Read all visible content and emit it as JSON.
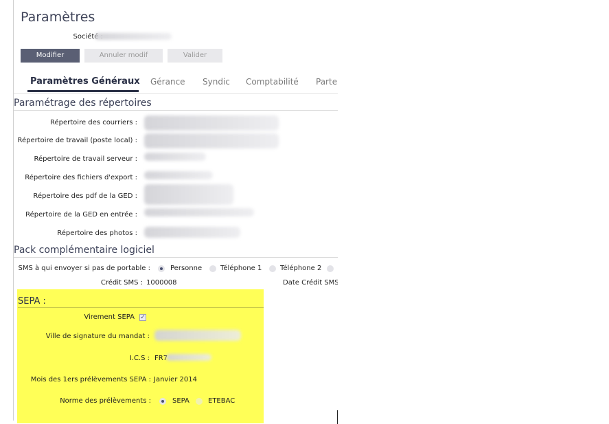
{
  "page": {
    "title": "Paramètres"
  },
  "company": {
    "label": "Société :"
  },
  "toolbar": {
    "modify": "Modifier",
    "cancel": "Annuler modif",
    "validate": "Valider"
  },
  "tabs": [
    {
      "label": "Paramètres Généraux",
      "active": true
    },
    {
      "label": "Gérance"
    },
    {
      "label": "Syndic"
    },
    {
      "label": "Comptabilité"
    },
    {
      "label": "Parte"
    }
  ],
  "directories": {
    "title": "Paramétrage des répertoires",
    "rows": [
      {
        "label": "Répertoire des courriers :"
      },
      {
        "label": "Répertoire de travail (poste local) :"
      },
      {
        "label": "Répertoire de travail serveur :"
      },
      {
        "label": "Répertoire des fichiers d'export :"
      },
      {
        "label": "Répertoire des pdf de la GED :"
      },
      {
        "label": "Répertoire de la GED en entrée :"
      },
      {
        "label": "Répertoire des photos :"
      }
    ]
  },
  "pack": {
    "title": "Pack complémentaire logiciel",
    "sms_label": "SMS à qui envoyer si pas de portable :",
    "sms_options": [
      "Personne",
      "Téléphone 1",
      "Téléphone 2"
    ],
    "sms_selected": "Personne",
    "credit_label": "Crédit SMS :",
    "credit_value": "1000008",
    "credit_date_label": "Date Crédit SMS"
  },
  "sepa": {
    "title": "SEPA :",
    "virement_label": "Virement SEPA",
    "virement_checked": true,
    "ville_label": "Ville de signature du mandat :",
    "ics_label": "I.C.S :",
    "ics_value": "FR7",
    "mois_label": "Mois des 1ers prélèvements SEPA :",
    "mois_value": "Janvier 2014",
    "norme_label": "Norme des prélèvements :",
    "norme_options": [
      "SEPA",
      "ETEBAC"
    ],
    "norme_selected": "SEPA"
  },
  "colors": {
    "primary_button": "#5a5f74",
    "tab_active": "#2b3147",
    "sepa_highlight": "#ffff57"
  }
}
